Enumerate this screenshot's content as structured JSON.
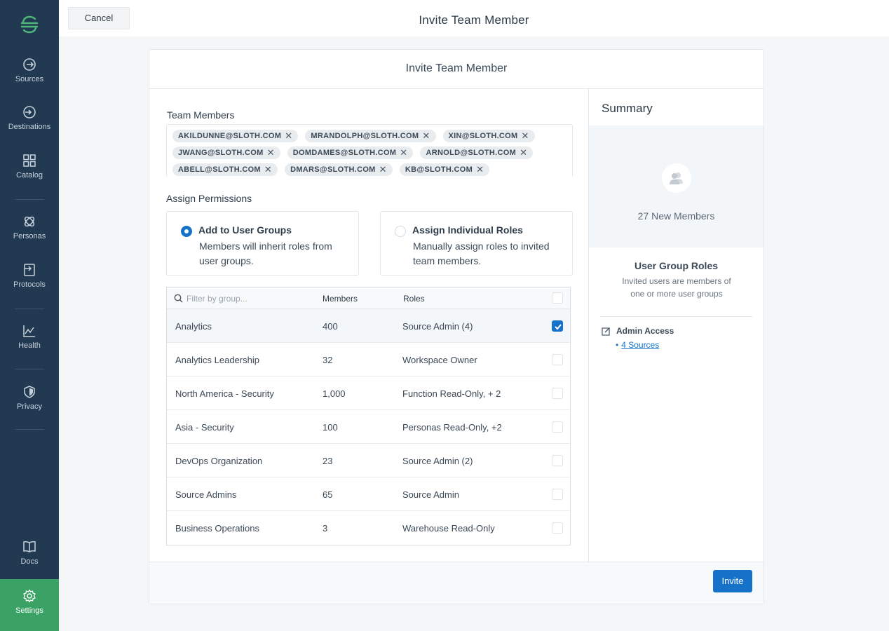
{
  "sidebar": {
    "logo_icon": "segment-logo",
    "items": [
      {
        "label": "Sources",
        "icon": "sources-icon"
      },
      {
        "label": "Destinations",
        "icon": "destinations-icon"
      },
      {
        "label": "Catalog",
        "icon": "catalog-icon"
      },
      {
        "label": "Personas",
        "icon": "personas-icon"
      },
      {
        "label": "Protocols",
        "icon": "protocols-icon"
      },
      {
        "label": "Health",
        "icon": "health-icon"
      },
      {
        "label": "Privacy",
        "icon": "privacy-icon"
      },
      {
        "label": "Docs",
        "icon": "docs-icon"
      },
      {
        "label": "Settings",
        "icon": "gear-icon",
        "active": true
      }
    ]
  },
  "topbar": {
    "cancel_label": "Cancel",
    "title": "Invite Team Member"
  },
  "card": {
    "title": "Invite Team Member",
    "team_members_label": "Team Members",
    "tag_rows": [
      [
        "AKILDUNNE@SLOTH.COM",
        "MRANDOLPH@SLOTH.COM",
        "XIN@SLOTH.COM"
      ],
      [
        "JWANG@SLOTH.COM",
        "DOMDAMES@SLOTH.COM",
        "ARNOLD@SLOTH.COM"
      ],
      [
        "ABELL@SLOTH.COM",
        "DMARS@SLOTH.COM",
        "KB@SLOTH.COM"
      ]
    ],
    "assign_permissions_label": "Assign Permissions",
    "options": [
      {
        "title": "Add to User Groups",
        "desc": "Members will inherit roles from user groups.",
        "selected": true
      },
      {
        "title": "Assign Individual Roles",
        "desc": "Manually assign roles to invited team members.",
        "selected": false
      }
    ],
    "table": {
      "filter_placeholder": "Filter by group...",
      "columns": {
        "members": "Members",
        "roles": "Roles"
      },
      "rows": [
        {
          "name": "Analytics",
          "members": "400",
          "roles": "Source Admin (4)",
          "checked": true
        },
        {
          "name": "Analytics Leadership",
          "members": "32",
          "roles": "Workspace Owner",
          "checked": false
        },
        {
          "name": "North America - Security",
          "members": "1,000",
          "roles": "Function Read-Only, + 2",
          "checked": false
        },
        {
          "name": "Asia - Security",
          "members": "100",
          "roles": "Personas Read-Only, +2",
          "checked": false
        },
        {
          "name": "DevOps Organization",
          "members": "23",
          "roles": "Source Admin (2)",
          "checked": false
        },
        {
          "name": "Source Admins",
          "members": "65",
          "roles": "Source Admin",
          "checked": false
        },
        {
          "name": "Business Operations",
          "members": "3",
          "roles": "Warehouse Read-Only",
          "checked": false
        }
      ]
    },
    "invite_label": "Invite"
  },
  "summary": {
    "title": "Summary",
    "new_members": "27 New Members",
    "ugr_title": "User Group Roles",
    "ugr_desc": "Invited users are members of one or more user groups",
    "admin_access": "Admin Access",
    "sources_link": "4 Sources"
  },
  "colors": {
    "sidebar_bg": "#213a52",
    "settings_active": "#3ba266",
    "primary": "#1572c8"
  }
}
